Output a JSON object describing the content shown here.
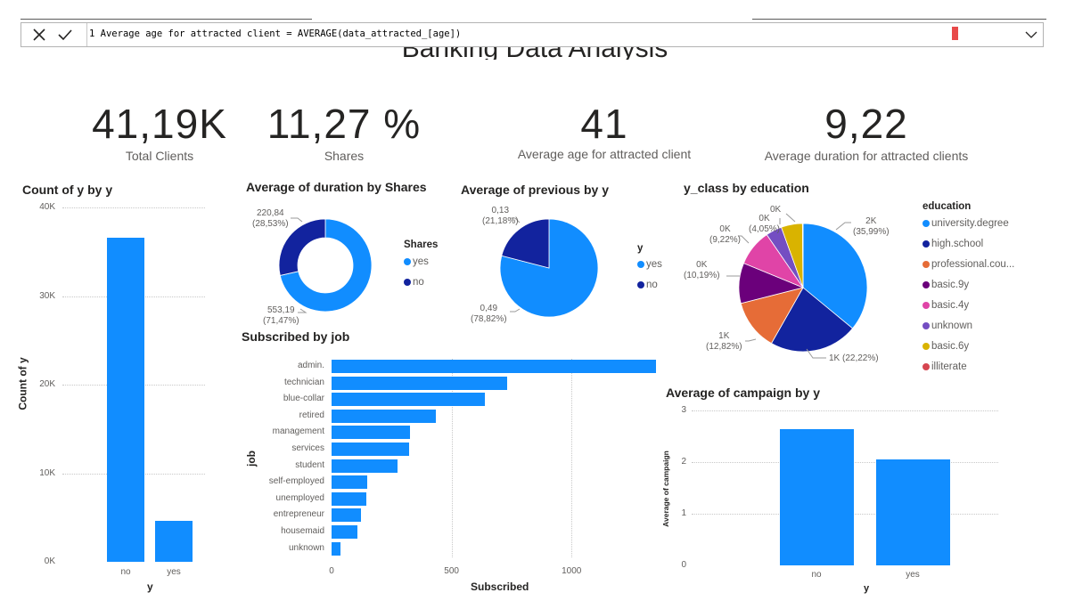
{
  "formula": {
    "line_number": "1",
    "text": "Average age for attracted client = AVERAGE(data_attracted_[age])"
  },
  "report": {
    "title": "Banking Data Analysis"
  },
  "kpis": [
    {
      "value": "41,19K",
      "label": "Total Clients"
    },
    {
      "value": "11,27 %",
      "label": "Shares"
    },
    {
      "value": "41",
      "label": "Average age for attracted client"
    },
    {
      "value": "9,22",
      "label": "Average duration for attracted clients"
    }
  ],
  "colors": {
    "blue": "#118dff",
    "darkblue": "#12239e",
    "orange": "#e66c37",
    "purple": "#6b007b",
    "pink": "#e044a7",
    "violet": "#744ec2",
    "yellow": "#d9b300",
    "red": "#d64550"
  },
  "charts": {
    "count_y": {
      "title": "Count of y by y",
      "xlabel": "y",
      "ylabel": "Count of y",
      "y_ticks": [
        "40K",
        "30K",
        "20K",
        "10K",
        "0K"
      ],
      "categories": [
        "no",
        "yes"
      ]
    },
    "duration_shares": {
      "title": "Average of duration by Shares",
      "legend_title": "Shares",
      "legend": [
        "yes",
        "no"
      ],
      "labels": {
        "no_value": "220,84",
        "no_pct": "(28,53%)",
        "yes_value": "553,19",
        "yes_pct": "(71,47%)"
      }
    },
    "previous_y": {
      "title": "Average of previous by y",
      "legend_title": "y",
      "legend": [
        "yes",
        "no"
      ],
      "labels": {
        "no_value": "0,13",
        "no_pct": "(21,18%)",
        "yes_value": "0,49",
        "yes_pct": "(78,82%)"
      }
    },
    "yclass_education": {
      "title": "y_class by education",
      "legend_title": "education",
      "legend": [
        "university.degree",
        "high.school",
        "professional.cou...",
        "basic.9y",
        "basic.4y",
        "unknown",
        "basic.6y",
        "illiterate"
      ],
      "labels": {
        "ud_value": "2K",
        "ud_pct": "(35,99%)",
        "hs": "1K (22,22%)",
        "pc_value": "1K",
        "pc_pct": "(12,82%)",
        "b9_value": "0K",
        "b9_pct": "(10,19%)",
        "b4_value": "0K",
        "b4_pct": "(9,22%)",
        "un_value": "0K",
        "un_pct": "(4,05%)",
        "b6_value": "0K"
      }
    },
    "subscribed_job": {
      "title": "Subscribed by job",
      "xlabel": "Subscribed",
      "ylabel": "job",
      "x_ticks": [
        "0",
        "500",
        "1000"
      ],
      "categories": [
        "admin.",
        "technician",
        "blue-collar",
        "retired",
        "management",
        "services",
        "student",
        "self-employed",
        "unemployed",
        "entrepreneur",
        "housemaid",
        "unknown"
      ]
    },
    "campaign_y": {
      "title": "Average of campaign by y",
      "xlabel": "y",
      "ylabel": "Average of campaign",
      "y_ticks": [
        "3",
        "2",
        "1",
        "0"
      ],
      "categories": [
        "no",
        "yes"
      ]
    }
  },
  "chart_data": [
    {
      "type": "bar",
      "title": "Count of y by y",
      "xlabel": "y",
      "ylabel": "Count of y",
      "categories": [
        "no",
        "yes"
      ],
      "values": [
        36548,
        4640
      ],
      "ylim": [
        0,
        40000
      ],
      "grid": true
    },
    {
      "type": "pie",
      "title": "Average of duration by Shares",
      "categories": [
        "yes",
        "no"
      ],
      "values": [
        553.19,
        220.84
      ],
      "legend": "right"
    },
    {
      "type": "pie",
      "title": "Average of previous by y",
      "categories": [
        "yes",
        "no"
      ],
      "values": [
        0.49,
        0.13
      ],
      "legend": "right"
    },
    {
      "type": "pie",
      "title": "y_class by education",
      "categories": [
        "university.degree",
        "high.school",
        "professional.cou...",
        "basic.9y",
        "basic.4y",
        "unknown",
        "basic.6y",
        "illiterate"
      ],
      "values": [
        35.99,
        22.22,
        12.82,
        10.19,
        9.22,
        4.05,
        5.36,
        0.15
      ],
      "legend": "right"
    },
    {
      "type": "bar",
      "title": "Subscribed by job",
      "xlabel": "Subscribed",
      "ylabel": "job",
      "categories": [
        "admin.",
        "technician",
        "blue-collar",
        "retired",
        "management",
        "services",
        "student",
        "self-employed",
        "unemployed",
        "entrepreneur",
        "housemaid",
        "unknown"
      ],
      "values": [
        1352,
        730,
        638,
        434,
        328,
        323,
        275,
        149,
        144,
        124,
        106,
        37
      ],
      "xlim": [
        0,
        1352
      ],
      "grid": true
    },
    {
      "type": "bar",
      "title": "Average of campaign by y",
      "xlabel": "y",
      "ylabel": "Average of campaign",
      "categories": [
        "no",
        "yes"
      ],
      "values": [
        2.63,
        2.05
      ],
      "ylim": [
        0,
        3
      ],
      "grid": true
    }
  ]
}
